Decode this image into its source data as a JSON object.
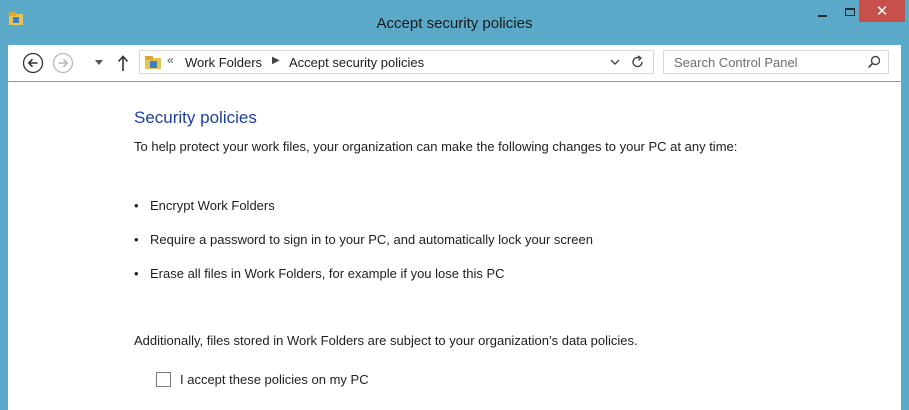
{
  "window": {
    "title": "Accept security policies",
    "close_glyph": "✕",
    "accent_color": "#5aa9c9",
    "close_color": "#c7504a"
  },
  "navigation": {
    "back_icon": "back-arrow-icon",
    "forward_icon": "forward-arrow-icon",
    "up_icon": "up-arrow-icon",
    "breadcrumb_prefix": "«",
    "breadcrumbs": [
      "Work Folders",
      "Accept security policies"
    ],
    "breadcrumb_separator": "▶",
    "search_placeholder": "Search Control Panel"
  },
  "main": {
    "heading": "Security policies",
    "heading_color": "#1e3f9e",
    "intro": "To help protect your work files, your organization can make the following changes to your PC at any time:",
    "bullet_char": "•",
    "policies": [
      "Encrypt Work Folders",
      "Require a password to sign in to your PC, and automatically lock your screen",
      "Erase all files in Work Folders, for example if you lose this PC"
    ],
    "additional": "Additionally, files stored in Work Folders are subject to your organization’s data policies.",
    "accept_label": "I accept these policies on my PC",
    "accept_checked": false
  }
}
